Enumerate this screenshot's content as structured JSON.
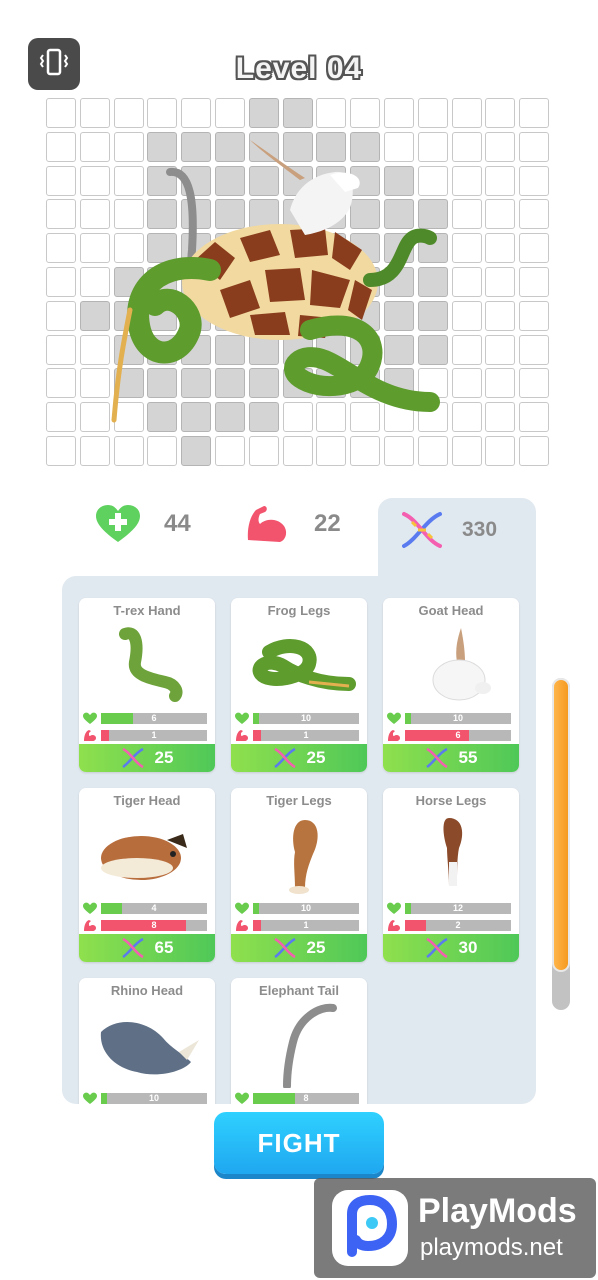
{
  "header": {
    "level_title": "Level 04"
  },
  "stats": {
    "health": "44",
    "strength": "22",
    "dna": "330"
  },
  "cards": [
    {
      "title": "T-rex Hand",
      "health": "6",
      "health_pct": 30,
      "strength": "1",
      "strength_pct": 8,
      "cost": "25"
    },
    {
      "title": "Frog Legs",
      "health": "10",
      "health_pct": 6,
      "strength": "1",
      "strength_pct": 8,
      "cost": "25"
    },
    {
      "title": "Goat Head",
      "health": "10",
      "health_pct": 6,
      "strength": "6",
      "strength_pct": 60,
      "cost": "55"
    },
    {
      "title": "Tiger Head",
      "health": "4",
      "health_pct": 20,
      "strength": "8",
      "strength_pct": 80,
      "cost": "65"
    },
    {
      "title": "Tiger Legs",
      "health": "10",
      "health_pct": 6,
      "strength": "1",
      "strength_pct": 8,
      "cost": "25"
    },
    {
      "title": "Horse Legs",
      "health": "12",
      "health_pct": 6,
      "strength": "2",
      "strength_pct": 20,
      "cost": "30"
    },
    {
      "title": "Rhino Head",
      "health": "10",
      "health_pct": 6,
      "strength": "",
      "strength_pct": 0,
      "cost": ""
    },
    {
      "title": "Elephant Tail",
      "health": "8",
      "health_pct": 40,
      "strength": "",
      "strength_pct": 0,
      "cost": ""
    }
  ],
  "fight_button": {
    "label": "FIGHT"
  },
  "watermark": {
    "title": "PlayMods",
    "url": "playmods.net"
  },
  "colors": {
    "health": "#69cc4d",
    "strength": "#f2536d",
    "cost_bar": "#4fc858",
    "fight": "#1fa7f0",
    "scroll_thumb": "#f59a20"
  }
}
